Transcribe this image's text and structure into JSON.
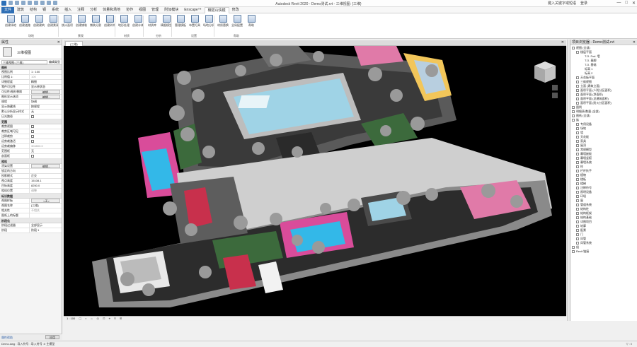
{
  "app": {
    "window_title": "Autodesk Revit 2020 - Demo测试.rvt - 三维视图: {三维}",
    "right_controls": [
      "键入关键字或短语",
      "登录"
    ],
    "window_buttons": [
      "—",
      "□",
      "✕"
    ]
  },
  "tabs": [
    "文件",
    "建筑",
    "结构",
    "钢",
    "系统",
    "插入",
    "注释",
    "分析",
    "体量和场地",
    "协作",
    "视图",
    "管理",
    "附加模块",
    "Enscape™",
    "橄榄山快模",
    "修改"
  ],
  "ribbon": {
    "buttons": [
      "创建场地",
      "创建道路",
      "创建建筑",
      "创建景观",
      "统计面积",
      "创建铺装",
      "铺装分割",
      "创建树木",
      "地形处理",
      "创建水体",
      "材质库",
      "精细模型",
      "管理模板",
      "布置灯具",
      "场地分析",
      "材质替换",
      "全局配置",
      "帮助"
    ],
    "groups": [
      "场地",
      "景观",
      "材质",
      "分析",
      "设置",
      "帮助"
    ]
  },
  "properties": {
    "title": "属性",
    "type_name": "三维视图",
    "type_selector": "三维视图: {三维}",
    "edit_type_label": "编辑类型",
    "sections": [
      {
        "name": "图形",
        "rows": [
          {
            "k": "视图比例",
            "v": "1 : 100"
          },
          {
            "k": "比例值 1:",
            "v": "100",
            "ro": true
          },
          {
            "k": "详细程度",
            "v": "精细"
          },
          {
            "k": "零件可见性",
            "v": "显示原状态"
          },
          {
            "k": "可见性/图形替换",
            "v": "编辑...",
            "btn": true
          },
          {
            "k": "图形显示选项",
            "v": "编辑...",
            "btn": true
          },
          {
            "k": "规程",
            "v": "协调"
          },
          {
            "k": "显示隐藏线",
            "v": "按规程"
          },
          {
            "k": "默认分析显示样式",
            "v": "无"
          },
          {
            "k": "日光路径",
            "v": "",
            "cb": true
          }
        ]
      },
      {
        "name": "范围",
        "rows": [
          {
            "k": "裁剪视图",
            "v": "",
            "cb": true
          },
          {
            "k": "裁剪区域可见",
            "v": "",
            "cb": true
          },
          {
            "k": "注释裁剪",
            "v": "",
            "cb": true
          },
          {
            "k": "远剪裁激活",
            "v": "",
            "cb": true
          },
          {
            "k": "远剪裁偏移",
            "v": "304800.0",
            "ro": true
          },
          {
            "k": "范围框",
            "v": "无"
          },
          {
            "k": "剖面框",
            "v": "",
            "cb": true
          }
        ]
      },
      {
        "name": "相机",
        "rows": [
          {
            "k": "渲染设置",
            "v": "编辑...",
            "btn": true
          },
          {
            "k": "锁定的方向",
            "v": "",
            "ro": true
          },
          {
            "k": "投影模式",
            "v": "正交"
          },
          {
            "k": "视点高度",
            "v": "15108.1"
          },
          {
            "k": "目标高度",
            "v": "8250.0"
          },
          {
            "k": "相机位置",
            "v": "调整",
            "ro": true
          }
        ]
      },
      {
        "name": "标识数据",
        "rows": [
          {
            "k": "视图样板",
            "v": "<无>",
            "btn": true
          },
          {
            "k": "视图名称",
            "v": "{三维}"
          },
          {
            "k": "相关性",
            "v": "不相关",
            "ro": true
          },
          {
            "k": "图纸上的标题",
            "v": ""
          }
        ]
      },
      {
        "name": "阶段化",
        "rows": [
          {
            "k": "阶段过滤器",
            "v": "全部显示"
          },
          {
            "k": "阶段",
            "v": "阶段 1"
          }
        ]
      }
    ],
    "help_label": "属性帮助",
    "apply_label": "应用"
  },
  "view_tab": {
    "label": "{三维}",
    "close": "✕"
  },
  "view_bar": {
    "scale": "1 : 100",
    "icons": "▢ ◐ ☼ ◎ ⊡ ⌖ ⚲ ⊞"
  },
  "browser": {
    "title": "项目浏览器 - Demo测试.rvt",
    "items": [
      {
        "lvl": 0,
        "t": "⊟",
        "label": "视图 (全部)"
      },
      {
        "lvl": 1,
        "t": "⊟",
        "label": "楼层平面"
      },
      {
        "lvl": 2,
        "t": "",
        "label": "T.O. Fnd. 墙"
      },
      {
        "lvl": 2,
        "t": "",
        "label": "T.O. 基脚"
      },
      {
        "lvl": 2,
        "t": "",
        "label": "T.O. 基础"
      },
      {
        "lvl": 2,
        "t": "",
        "label": "标高 1"
      },
      {
        "lvl": 2,
        "t": "",
        "label": "标高 2"
      },
      {
        "lvl": 1,
        "t": "⊞",
        "label": "天花板平面"
      },
      {
        "lvl": 1,
        "t": "⊞",
        "label": "三维视图"
      },
      {
        "lvl": 1,
        "t": "⊞",
        "label": "立面 (建筑立面)"
      },
      {
        "lvl": 1,
        "t": "⊞",
        "label": "面积平面 (人防分区面积)"
      },
      {
        "lvl": 1,
        "t": "⊞",
        "label": "面积平面 (净面积)"
      },
      {
        "lvl": 1,
        "t": "⊞",
        "label": "面积平面 (总建筑面积)"
      },
      {
        "lvl": 1,
        "t": "⊞",
        "label": "面积平面 (防火分区面积)"
      },
      {
        "lvl": 0,
        "t": "⊞",
        "label": "图例"
      },
      {
        "lvl": 0,
        "t": "⊞",
        "label": "明细表/数量 (全部)"
      },
      {
        "lvl": 0,
        "t": "⊞",
        "label": "图纸 (全部)"
      },
      {
        "lvl": 0,
        "t": "⊟",
        "label": "族"
      },
      {
        "lvl": 1,
        "t": "⊞",
        "label": "专用设备"
      },
      {
        "lvl": 1,
        "t": "⊞",
        "label": "场地"
      },
      {
        "lvl": 1,
        "t": "⊞",
        "label": "墙"
      },
      {
        "lvl": 1,
        "t": "⊞",
        "label": "天花板"
      },
      {
        "lvl": 1,
        "t": "⊞",
        "label": "家具"
      },
      {
        "lvl": 1,
        "t": "⊞",
        "label": "屋顶"
      },
      {
        "lvl": 1,
        "t": "⊞",
        "label": "常规模型"
      },
      {
        "lvl": 1,
        "t": "⊞",
        "label": "幕墙嵌板"
      },
      {
        "lvl": 1,
        "t": "⊞",
        "label": "幕墙竖梃"
      },
      {
        "lvl": 1,
        "t": "⊞",
        "label": "幕墙系统"
      },
      {
        "lvl": 1,
        "t": "⊞",
        "label": "柱"
      },
      {
        "lvl": 1,
        "t": "⊞",
        "label": "栏杆扶手"
      },
      {
        "lvl": 1,
        "t": "⊞",
        "label": "植物"
      },
      {
        "lvl": 1,
        "t": "⊞",
        "label": "楼板"
      },
      {
        "lvl": 1,
        "t": "⊞",
        "label": "楼梯"
      },
      {
        "lvl": 1,
        "t": "⊞",
        "label": "注释符号"
      },
      {
        "lvl": 1,
        "t": "⊞",
        "label": "照明设备"
      },
      {
        "lvl": 1,
        "t": "⊞",
        "label": "环境"
      },
      {
        "lvl": 1,
        "t": "⊞",
        "label": "窗"
      },
      {
        "lvl": 1,
        "t": "⊞",
        "label": "管道系统"
      },
      {
        "lvl": 1,
        "t": "⊞",
        "label": "结构柱"
      },
      {
        "lvl": 1,
        "t": "⊞",
        "label": "结构框架"
      },
      {
        "lvl": 1,
        "t": "⊞",
        "label": "结构基础"
      },
      {
        "lvl": 1,
        "t": "⊞",
        "label": "详图项目"
      },
      {
        "lvl": 1,
        "t": "⊞",
        "label": "轮廓"
      },
      {
        "lvl": 1,
        "t": "⊞",
        "label": "配景"
      },
      {
        "lvl": 1,
        "t": "⊞",
        "label": "门"
      },
      {
        "lvl": 1,
        "t": "⊞",
        "label": "风管"
      },
      {
        "lvl": 1,
        "t": "⊞",
        "label": "风管系统"
      },
      {
        "lvl": 0,
        "t": "⊞",
        "label": "组"
      },
      {
        "lvl": 0,
        "t": "⊞",
        "label": "Revit 链接"
      }
    ]
  },
  "status": {
    "left": "Demo.dwg : 导入符号 : 导入符号",
    "mid": ":0",
    "model": "主模型",
    "filter": "▽:0"
  }
}
